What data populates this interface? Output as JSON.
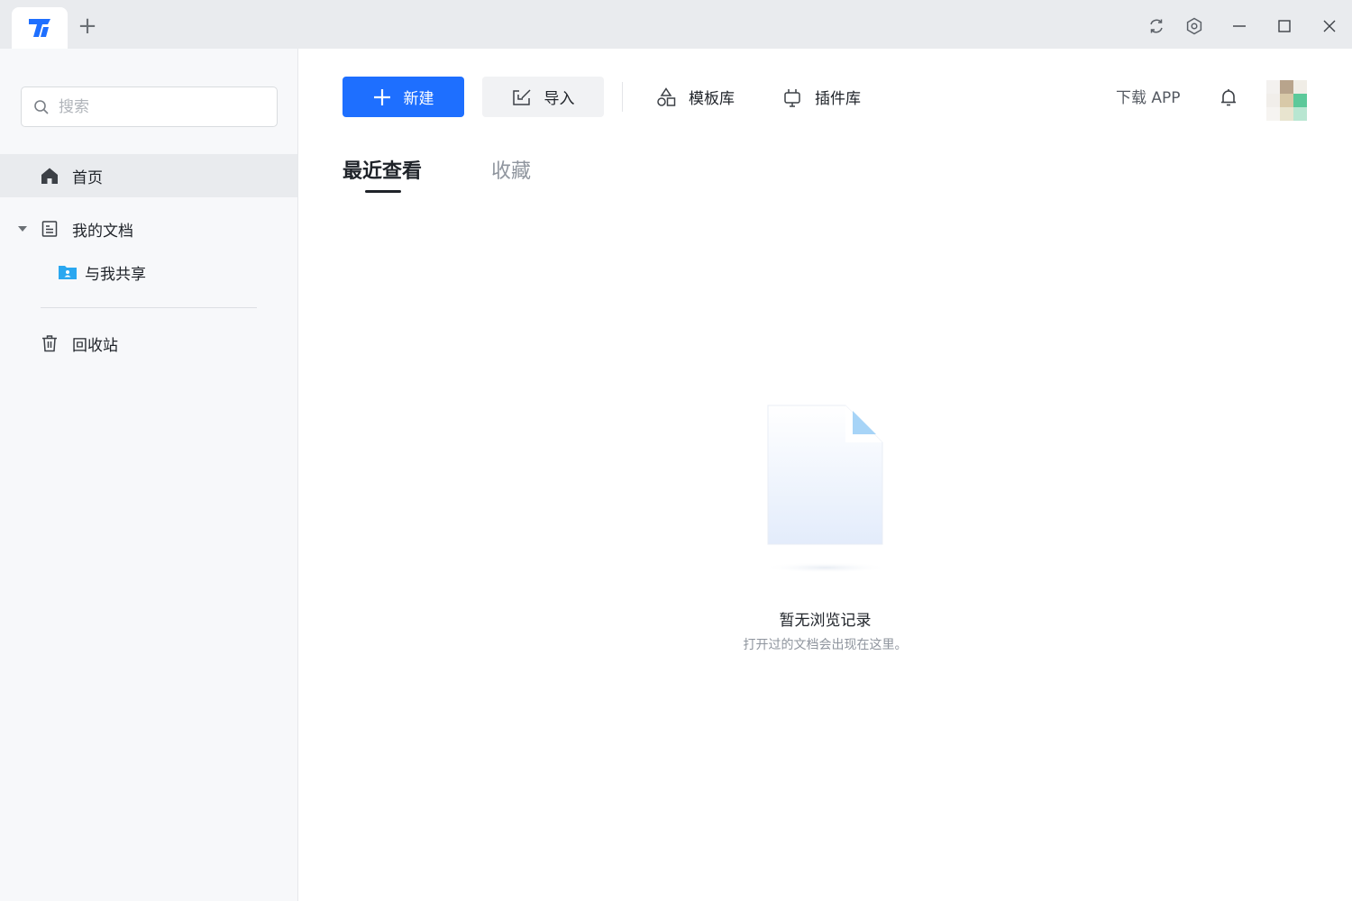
{
  "titlebar": {
    "new_tab_symbol": "+",
    "controls": [
      "refresh-icon",
      "settings-icon",
      "minimize-icon",
      "maximize-icon",
      "close-icon"
    ]
  },
  "sidebar": {
    "search_placeholder": "搜索",
    "items": [
      {
        "label": "首页",
        "icon": "home-icon",
        "active": true
      },
      {
        "label": "我的文档",
        "icon": "document-icon",
        "expanded": true
      },
      {
        "label": "与我共享",
        "icon": "shared-folder-icon"
      },
      {
        "label": "回收站",
        "icon": "trash-icon"
      }
    ]
  },
  "toolbar": {
    "new_label": "新建",
    "import_label": "导入",
    "templates_label": "模板库",
    "plugins_label": "插件库",
    "download_label": "下载 APP"
  },
  "tabs": [
    {
      "label": "最近查看",
      "active": true
    },
    {
      "label": "收藏",
      "active": false
    }
  ],
  "empty_state": {
    "title": "暂无浏览记录",
    "subtitle": "打开过的文档会出现在这里。"
  },
  "colors": {
    "accent": "#1e6fff",
    "sidebar_bg": "#f7f8fa",
    "titlebar_bg": "#e9ebee",
    "shared_folder": "#2aa7f0"
  }
}
